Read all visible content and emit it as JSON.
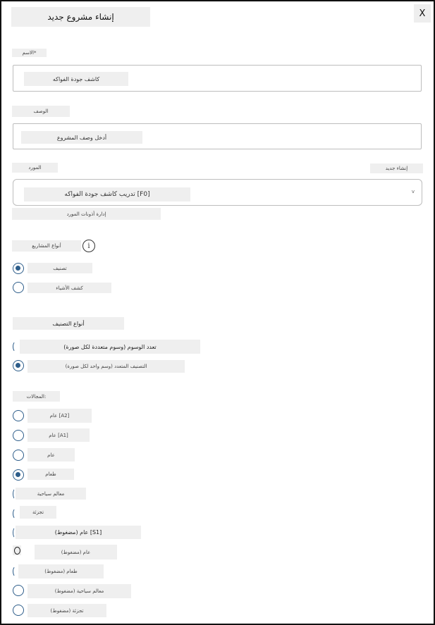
{
  "dialog": {
    "title": "إنشاء مشروع جديد",
    "close_label": "X"
  },
  "name_field": {
    "label": "الاسم*",
    "value": "كاشف جودة الفواكه"
  },
  "description_field": {
    "label": "الوصف",
    "placeholder": "أدخل وصف المشروع"
  },
  "resource_field": {
    "label": "المورد",
    "create_new_label": "إنشاء جديد",
    "selected_value": "تدريب كاشف جودة الفواكه [F0]",
    "manage_link": "إدارة أذونات المورد"
  },
  "project_types": {
    "label": "أنواع المشاريع",
    "info_icon": "i",
    "options": [
      {
        "label": "تصنيف",
        "checked": true
      },
      {
        "label": "كشف الأشياء",
        "checked": false
      }
    ]
  },
  "classification_types": {
    "label": "أنواع التصنيف",
    "options": [
      {
        "label": "تعدد الوسوم (وسوم متعددة لكل صورة)",
        "checked": false
      },
      {
        "label": "التصنيف المتعدد (وسم واحد لكل صورة)",
        "checked": true
      }
    ]
  },
  "domains": {
    "label": "المجالات:",
    "options": [
      {
        "label": "عام [A2]",
        "checked": false
      },
      {
        "label": "عام [A1]",
        "checked": false
      },
      {
        "label": "عام",
        "checked": false
      },
      {
        "label": "طعام",
        "checked": true
      },
      {
        "label": "معالم سياحية",
        "checked": false
      },
      {
        "label": "تجزئة",
        "checked": false
      },
      {
        "label": "عام (مضغوط) [S1]",
        "checked": false
      },
      {
        "label": "عام (مضغوط)",
        "checked": false
      },
      {
        "label": "طعام (مضغوط)",
        "checked": false
      },
      {
        "label": "معالم سياحية (مضغوط)",
        "checked": false
      },
      {
        "label": "تجزئة (مضغوط)",
        "checked": false
      }
    ]
  }
}
